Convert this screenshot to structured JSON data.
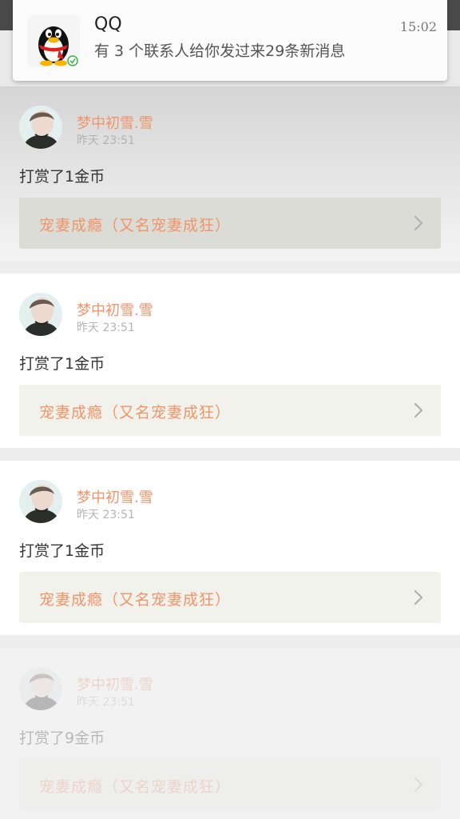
{
  "notification": {
    "app_name": "QQ",
    "message": "有 3 个联系人给你发过来29条新消息",
    "time": "15:02",
    "icon": "qq-penguin-icon"
  },
  "feed": {
    "items": [
      {
        "username": "梦中初雪.雪",
        "time": "昨天 23:51",
        "message": "打赏了1金币",
        "book_title": "宠妻成瘾（又名宠妻成狂）"
      },
      {
        "username": "梦中初雪.雪",
        "time": "昨天 23:51",
        "message": "打赏了1金币",
        "book_title": "宠妻成瘾（又名宠妻成狂）"
      },
      {
        "username": "梦中初雪.雪",
        "time": "昨天 23:51",
        "message": "打赏了1金币",
        "book_title": "宠妻成瘾（又名宠妻成狂）"
      },
      {
        "username": "梦中初雪.雪",
        "time": "昨天 23:51",
        "message": "打赏了9金币",
        "book_title": "宠妻成瘾（又名宠妻成狂）"
      }
    ]
  },
  "colors": {
    "accent": "#f0946a",
    "status_bar": "#4a4a4a",
    "link_background": "#f2f2ec"
  }
}
